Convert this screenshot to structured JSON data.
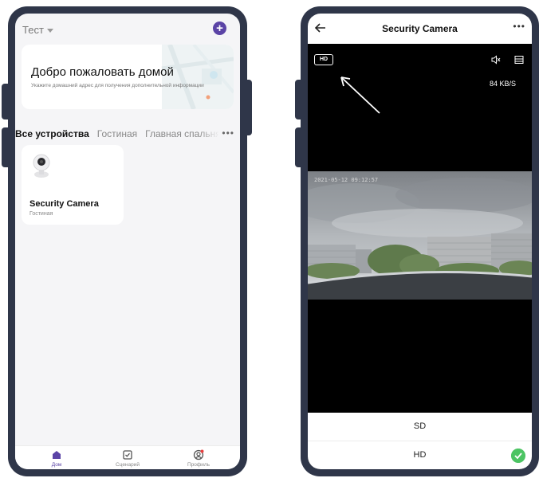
{
  "left": {
    "home_name": "Тест",
    "welcome": {
      "title": "Добро пожаловать домой",
      "subtitle": "Укажите домашний адрес для получения дополнительной информации"
    },
    "tabs": [
      "Все устройства",
      "Гостиная",
      "Главная спальня"
    ],
    "more": "•••",
    "device": {
      "name": "Security Camera",
      "room": "Гостиная"
    },
    "nav": {
      "home": "Дом",
      "scenes": "Сценарий",
      "profile": "Профиль"
    }
  },
  "right": {
    "title": "Security Camera",
    "more": "•••",
    "quality_badge": "HD",
    "bitrate": "84 KB/S",
    "osd_text": "2021-05-12 09:12:57",
    "quality_options": [
      "SD",
      "HD"
    ],
    "selected_quality": "HD"
  },
  "colors": {
    "accent": "#5b44a6",
    "success": "#4cc463",
    "frame": "#2f3649"
  }
}
